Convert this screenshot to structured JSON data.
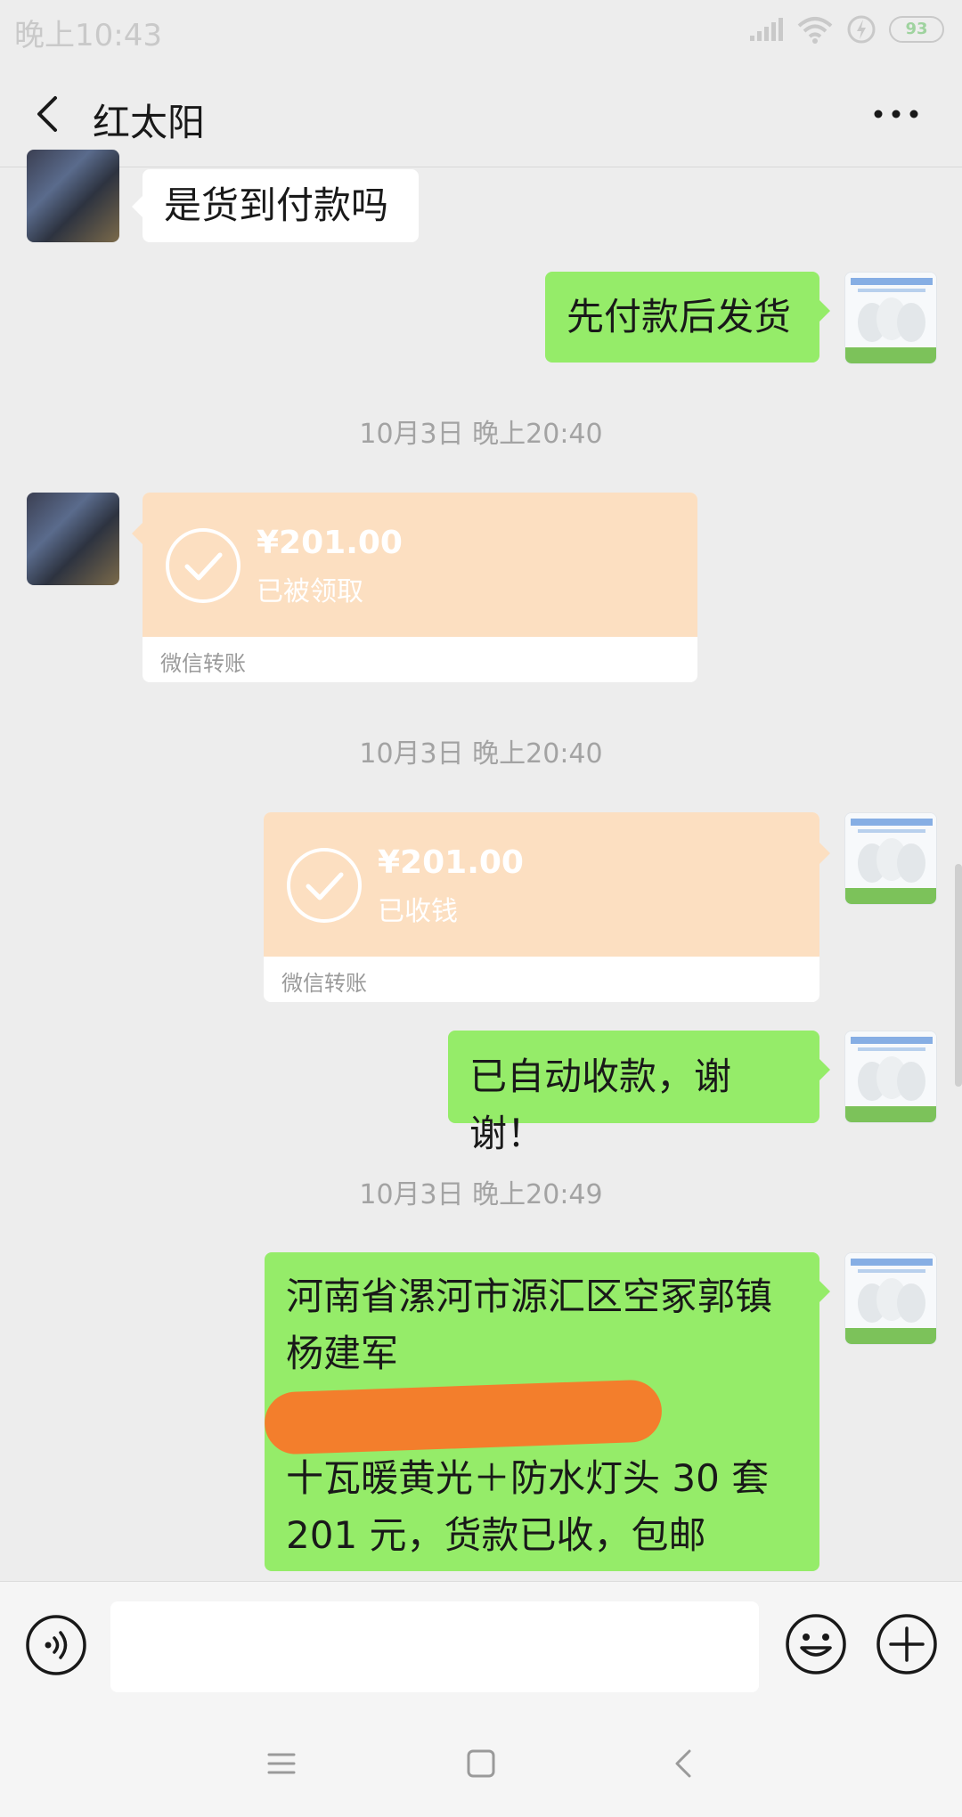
{
  "status_bar": {
    "time": "晚上10:43",
    "battery": "93"
  },
  "header": {
    "title": "红太阳"
  },
  "messages": {
    "m1": {
      "text": "是货到付款吗"
    },
    "m2": {
      "text": "先付款后发货"
    },
    "ts1": "10月3日 晚上20:40",
    "transfer1": {
      "amount": "¥201.00",
      "status": "已被领取",
      "footer": "微信转账"
    },
    "ts2": "10月3日 晚上20:40",
    "transfer2": {
      "amount": "¥201.00",
      "status": "已收钱",
      "footer": "微信转账"
    },
    "m3": {
      "text": "已自动收款，谢谢！"
    },
    "ts3": "10月3日 晚上20:49",
    "m4": {
      "line1": "河南省漯河市源汇区空冢郭镇",
      "line2": "杨建军",
      "line3": "十瓦暖黄光＋防水灯头 30 套",
      "line4": "201 元，货款已收，包邮"
    }
  },
  "input": {
    "placeholder": ""
  },
  "colors": {
    "background": "#ededed",
    "bubble_green": "#95ec69",
    "bubble_white": "#ffffff",
    "transfer_peach": "#fcdfc1",
    "redaction": "#f37e2c"
  },
  "icons": [
    "back-arrow-icon",
    "more-dots-icon",
    "signal-icon",
    "wifi-icon",
    "battery-icon",
    "check-circle-icon",
    "voice-icon",
    "emoji-icon",
    "plus-icon",
    "menu-icon",
    "home-icon",
    "nav-back-icon"
  ]
}
